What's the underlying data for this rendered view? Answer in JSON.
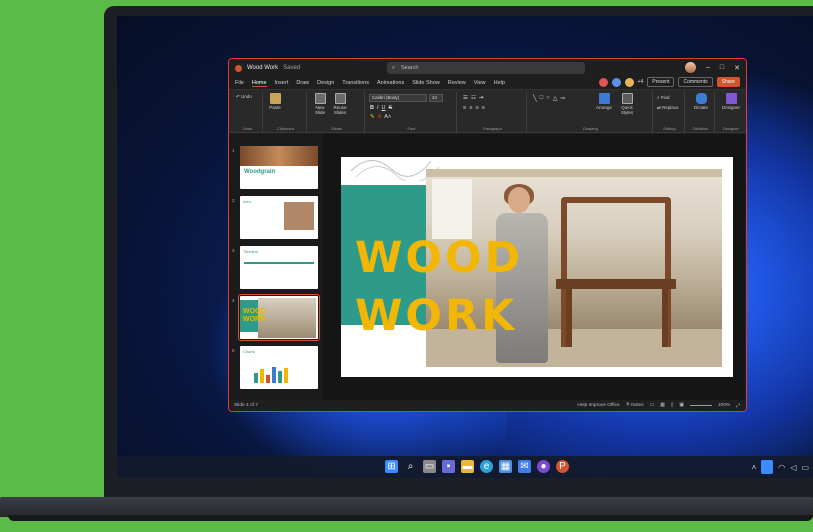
{
  "app": {
    "title": "Wood Work",
    "saved_status": "Saved",
    "search_placeholder": "Search",
    "menu": [
      "File",
      "Home",
      "Insert",
      "Draw",
      "Design",
      "Transitions",
      "Animations",
      "Slide Show",
      "Review",
      "View",
      "Help"
    ],
    "active_menu": "Home",
    "collab_count": "+4",
    "present_label": "Present",
    "comments_label": "Comments",
    "share_label": "Share",
    "accent": "#d35230"
  },
  "ribbon": {
    "undo": "Undo",
    "paste": "Paste",
    "new_slide": "New Slide",
    "reuse_slides": "Reuse Slides",
    "font_name": "Calibri (Body)",
    "font_size": "24",
    "arrange": "Arrange",
    "quick_styles": "Quick Styles",
    "find": "Find",
    "replace": "Replace",
    "dictate": "Dictate",
    "designer": "Designer",
    "groups": [
      "Undo",
      "Clipboard",
      "Slides",
      "Font",
      "Paragraph",
      "Drawing",
      "Editing",
      "Dictation",
      "Designer"
    ]
  },
  "thumbnails": {
    "slide1_title": "Woodgrain",
    "slide2_label": "Intro",
    "slide3_label": "Timeline",
    "slide4_text": "WOOD WORK",
    "slide5_label": "Charts"
  },
  "slide": {
    "line1": "WOOD",
    "line2": "WORK",
    "title_color": "#f2b705",
    "accent_block_color": "#2e9a8a"
  },
  "status": {
    "slide_position": "Slide 4 of 7",
    "help_improve": "Help Improve Office",
    "notes": "Notes",
    "zoom": "100%"
  }
}
